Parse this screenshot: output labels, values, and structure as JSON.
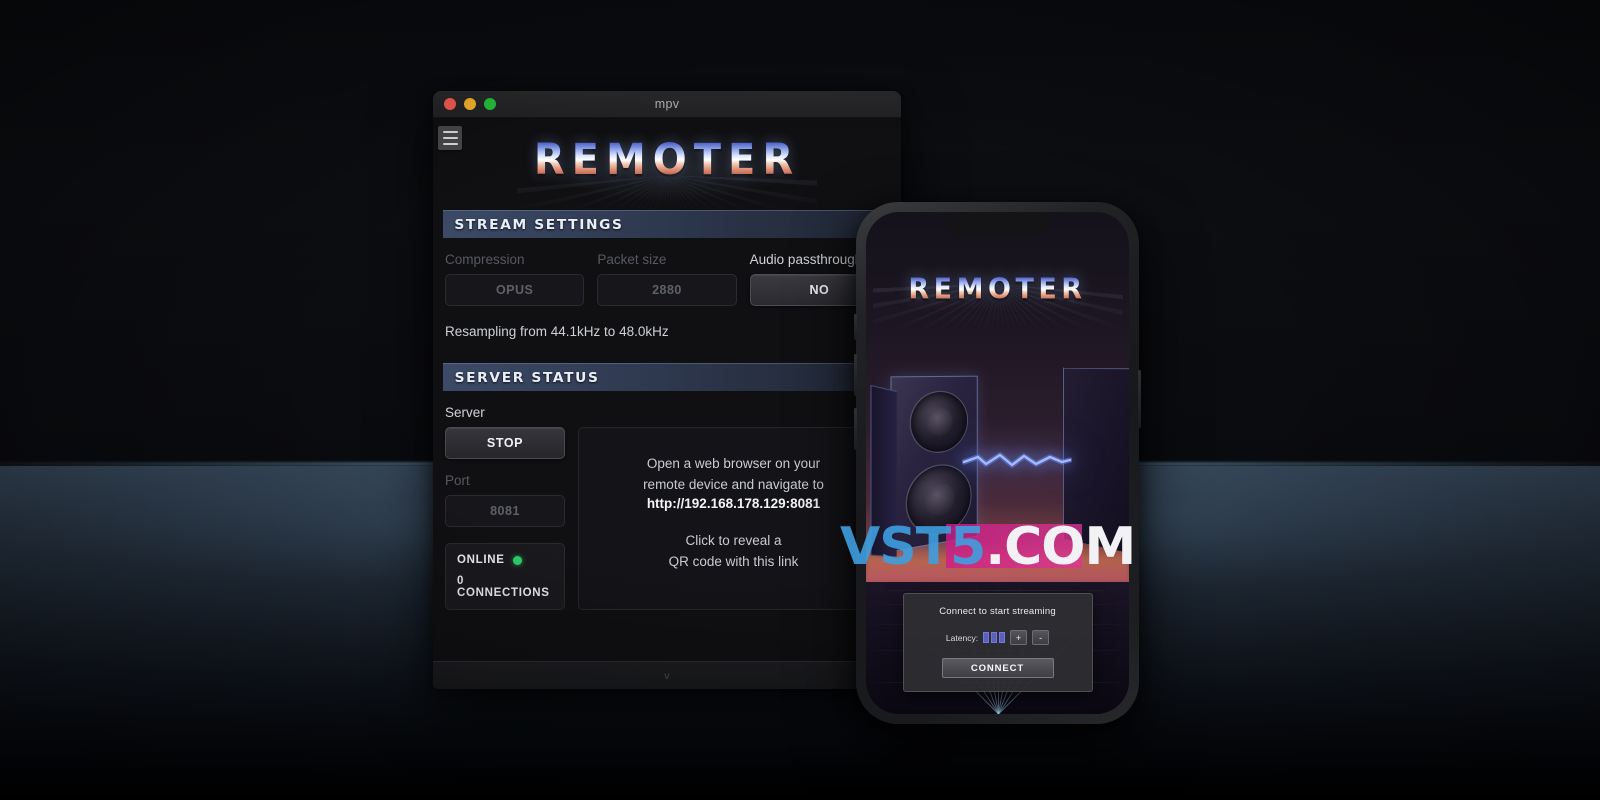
{
  "window": {
    "title": "mpv",
    "traffic_lights": [
      "close",
      "minimize",
      "maximize"
    ],
    "menu_icon": "hamburger-icon",
    "footer_version": "v"
  },
  "app": {
    "logo": "REMOTER",
    "sections": {
      "stream": {
        "header": "STREAM SETTINGS",
        "fields": [
          {
            "label": "Compression",
            "value": "OPUS",
            "state": "disabled"
          },
          {
            "label": "Packet size",
            "value": "2880",
            "state": "disabled"
          },
          {
            "label": "Audio passthrough",
            "value": "NO",
            "state": "enabled"
          }
        ],
        "resampling": "Resampling from 44.1kHz to 48.0kHz"
      },
      "server": {
        "header": "SERVER STATUS",
        "server_label": "Server",
        "server_button": "STOP",
        "port_label": "Port",
        "port_value": "8081",
        "status": "ONLINE",
        "status_color": "#2fd06b",
        "connections": "0 CONNECTIONS",
        "info_line1": "Open a web browser on your",
        "info_line2": "remote device and navigate to",
        "info_url": "http://192.168.178.129:8081",
        "info_line3": "Click to reveal a",
        "info_line4": "QR code with this link"
      }
    }
  },
  "phone": {
    "logo": "REMOTER",
    "dialog": {
      "title": "Connect to start streaming",
      "latency_label": "Latency:",
      "latency_level": 3,
      "latency_max": 3,
      "increase_label": "+",
      "decrease_label": "-",
      "connect_label": "CONNECT"
    }
  },
  "watermark": {
    "primary": "VST5",
    "secondary": ".COM",
    "primary_color": "#3f9fe0",
    "band_color": "#cd1e87"
  }
}
